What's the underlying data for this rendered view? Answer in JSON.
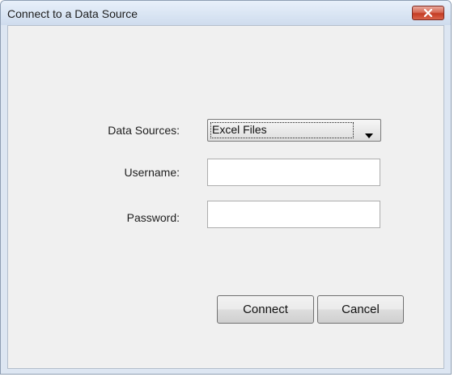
{
  "window": {
    "title": "Connect to a Data Source"
  },
  "icons": {
    "close": "close-icon",
    "dropdown": "dropdown-arrow-icon"
  },
  "form": {
    "data_sources_label": "Data Sources:",
    "data_sources_value": "Excel Files",
    "username_label": "Username:",
    "username_value": "",
    "password_label": "Password:",
    "password_value": ""
  },
  "buttons": {
    "connect": "Connect",
    "cancel": "Cancel"
  },
  "colors": {
    "titlebar": "#dbe6f4",
    "close_button": "#c43c24",
    "client_background": "#f0f0f0"
  }
}
